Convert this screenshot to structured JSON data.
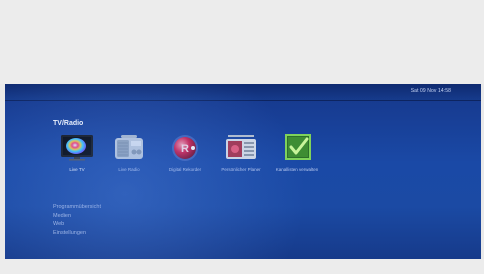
{
  "header": {
    "clock": "Sat 09 Nov 14:58"
  },
  "section_title": "TV/Radio",
  "apps": [
    {
      "id": "live-tv",
      "label": "Live TV",
      "icon": "tv-icon",
      "selected": true
    },
    {
      "id": "live-radio",
      "label": "Live Radio",
      "icon": "radio-icon",
      "selected": false
    },
    {
      "id": "digital-recorder",
      "label": "Digital Rekorder",
      "icon": "recorder-icon",
      "selected": false
    },
    {
      "id": "persoenlicher-planer",
      "label": "Persönlicher Planer",
      "icon": "planner-icon",
      "selected": false
    },
    {
      "id": "kanaele-verwalten",
      "label": "Kanallisten verwalten",
      "icon": "checklist-icon",
      "selected": false
    }
  ],
  "menu": {
    "items": [
      {
        "label": "Programmübersicht"
      },
      {
        "label": "Medien"
      },
      {
        "label": "Web"
      },
      {
        "label": "Einstellungen"
      }
    ]
  },
  "colors": {
    "screen_blue": "#1a49a6",
    "header_blue": "#0f2a70",
    "frame_gray": "#ececec"
  }
}
